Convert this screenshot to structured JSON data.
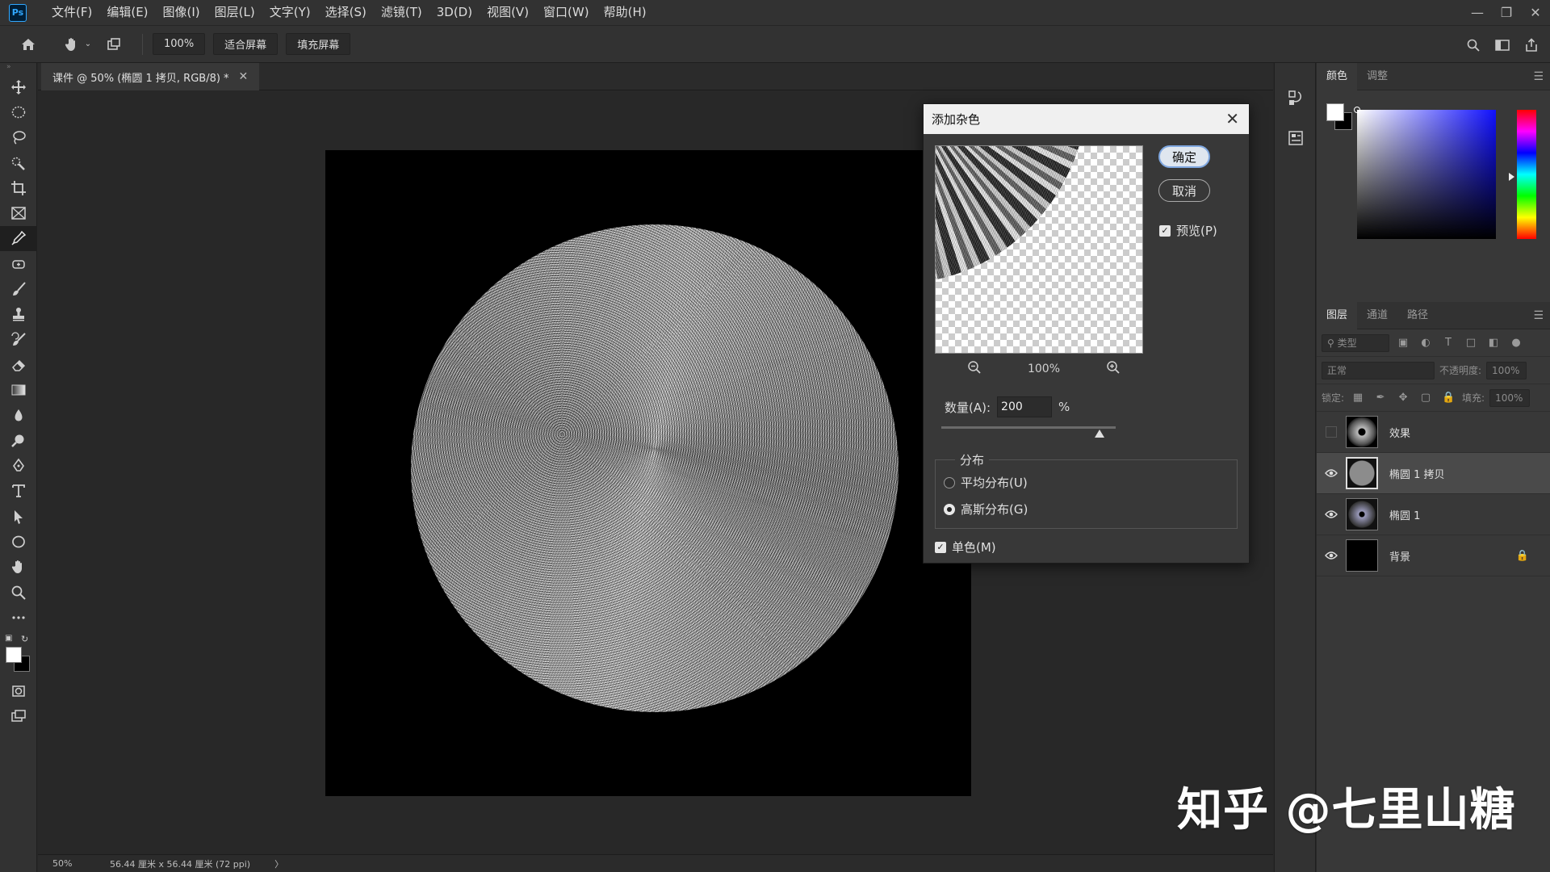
{
  "app": {
    "logo": "Ps",
    "menus": [
      "文件(F)",
      "编辑(E)",
      "图像(I)",
      "图层(L)",
      "文字(Y)",
      "选择(S)",
      "滤镜(T)",
      "3D(D)",
      "视图(V)",
      "窗口(W)",
      "帮助(H)"
    ]
  },
  "options": {
    "zoom": "100%",
    "fit_screen": "适合屏幕",
    "fill_screen": "填充屏幕"
  },
  "document": {
    "tab_title": "课件 @ 50% (椭圆 1 拷贝, RGB/8) *",
    "status_zoom": "50%",
    "status_info": "56.44 厘米 x 56.44 厘米 (72 ppi)",
    "status_arrow": "〉"
  },
  "color_panel": {
    "tabs": [
      "颜色",
      "调整"
    ],
    "colors": {
      "foreground": "#ffffff",
      "background": "#000000"
    }
  },
  "layers_panel": {
    "tabs": [
      "图层",
      "通道",
      "路径"
    ],
    "filter_placeholder": "类型",
    "blend_mode": "正常",
    "opacity_label": "不透明度:",
    "opacity_value": "100%",
    "lock_label": "锁定:",
    "fill_label": "填充:",
    "fill_value": "100%",
    "layers": [
      {
        "name": "效果",
        "visible": false,
        "selected": false
      },
      {
        "name": "椭圆 1 拷贝",
        "visible": true,
        "selected": true
      },
      {
        "name": "椭圆 1",
        "visible": true,
        "selected": false
      },
      {
        "name": "背景",
        "visible": true,
        "selected": false,
        "locked": true
      }
    ]
  },
  "dialog": {
    "title": "添加杂色",
    "ok_label": "确定",
    "cancel_label": "取消",
    "preview_label": "预览(P)",
    "zoom_value": "100%",
    "amount_label": "数量(A):",
    "amount_value": "200",
    "amount_unit": "%",
    "distribution_label": "分布",
    "uniform_label": "平均分布(U)",
    "gaussian_label": "高斯分布(G)",
    "selected_distribution": "gaussian",
    "monochrome_label": "单色(M)",
    "monochrome_checked": true,
    "preview_checked": true
  },
  "watermark": "知乎 @七里山糖"
}
